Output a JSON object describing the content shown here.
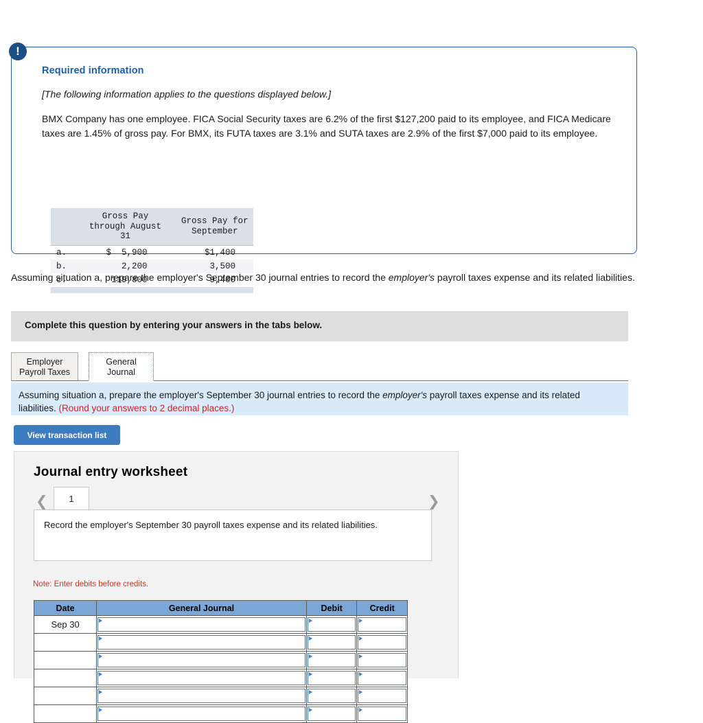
{
  "alert": {
    "icon": "exclamation-icon",
    "glyph": "!"
  },
  "required_info": {
    "title": "Required information",
    "italic_note": "[The following information applies to the questions displayed below.]",
    "body": "BMX Company has one employee. FICA Social Security taxes are 6.2% of the first $127,200 paid to its employee, and FICA Medicare taxes are 1.45% of gross pay. For BMX, its FUTA taxes are 3.1% and SUTA taxes are 2.9% of the first $7,000 paid to its employee."
  },
  "gross_pay_table": {
    "headers": [
      "",
      "Gross Pay through August 31",
      "Gross Pay for September"
    ],
    "header_line1": "Gross Pay",
    "header_line2": "through August",
    "header_line3": "31",
    "header2_line1": "Gross Pay for",
    "header2_line2": "September",
    "rows": [
      {
        "label": "a.",
        "through_august": "$  5,900",
        "september": "$1,400"
      },
      {
        "label": "b.",
        "through_august": "2,200",
        "september": "3,500"
      },
      {
        "label": "c.",
        "through_august": "119,800",
        "september": "9,400"
      }
    ]
  },
  "question": {
    "part1": "Assuming situation a, prepare the employer's September 30 journal entries to record the ",
    "emphasis": "employer's",
    "part2": " payroll taxes expense and its related liabilities."
  },
  "complete_bar": {
    "text": "Complete this question by entering your answers in the tabs below."
  },
  "tabs": [
    {
      "id": "employer-payroll-taxes",
      "line1": "Employer",
      "line2": "Payroll Taxes",
      "active": false
    },
    {
      "id": "general-journal",
      "line1": "General",
      "line2": "Journal",
      "active": true
    }
  ],
  "blue_panel": {
    "part1": "Assuming situation a, prepare the employer's September 30 journal entries to record the ",
    "emphasis": "employer's",
    "part2": " payroll taxes expense and its related liabilities. ",
    "rounding_note": "(Round your answers to 2 decimal places.)"
  },
  "view_transaction_button": {
    "label": "View transaction list"
  },
  "worksheet": {
    "title": "Journal entry worksheet",
    "prev_icon": "chevron-left-icon",
    "next_icon": "chevron-right-icon",
    "page_tab_label": "1",
    "description": "Record the employer's September 30 payroll taxes expense and its related liabilities.",
    "note": "Note: Enter debits before credits."
  },
  "journal_table": {
    "columns": [
      "Date",
      "General Journal",
      "Debit",
      "Credit"
    ],
    "rows": [
      {
        "date": "Sep 30",
        "general_journal": "",
        "debit": "",
        "credit": ""
      },
      {
        "date": "",
        "general_journal": "",
        "debit": "",
        "credit": ""
      },
      {
        "date": "",
        "general_journal": "",
        "debit": "",
        "credit": ""
      },
      {
        "date": "",
        "general_journal": "",
        "debit": "",
        "credit": ""
      },
      {
        "date": "",
        "general_journal": "",
        "debit": "",
        "credit": ""
      },
      {
        "date": "",
        "general_journal": "",
        "debit": "",
        "credit": ""
      }
    ]
  },
  "colors": {
    "accent_blue": "#1f5fa9",
    "badge_navy": "#1c4f86",
    "button_blue": "#3d7cc0",
    "table_header_blue": "#7ba7d7",
    "panel_light_blue": "#d9eaf9",
    "bar_gray": "#dedede",
    "worksheet_gray": "#f2f2f2",
    "alert_red": "#c0392b"
  }
}
